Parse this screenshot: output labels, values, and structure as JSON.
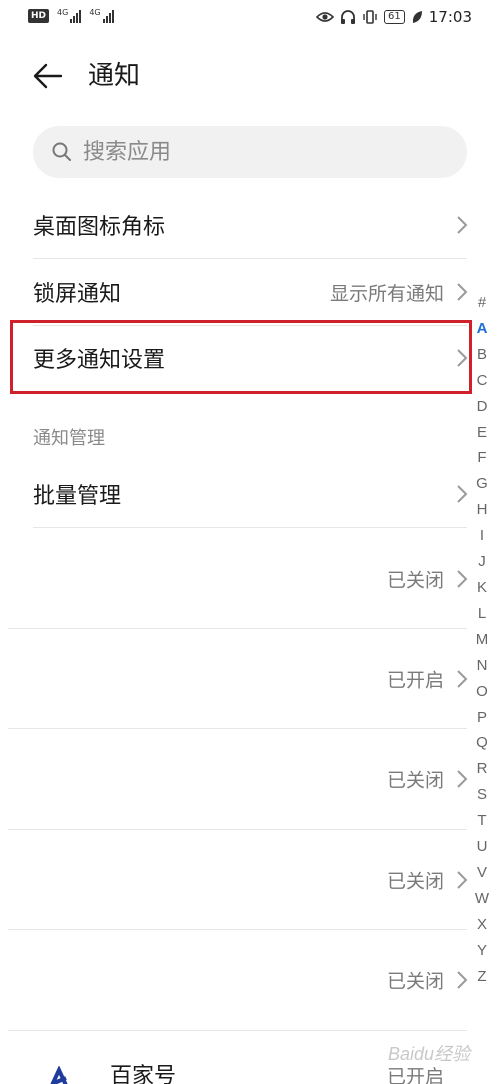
{
  "status_bar": {
    "hd_badge": "HD",
    "signal_1": "4G",
    "signal_2": "4G",
    "battery": "61",
    "time": "17:03"
  },
  "header": {
    "title": "通知"
  },
  "search": {
    "placeholder": "搜索应用"
  },
  "settings": [
    {
      "label": "桌面图标角标",
      "value": ""
    },
    {
      "label": "锁屏通知",
      "value": "显示所有通知"
    },
    {
      "label": "更多通知设置",
      "value": ""
    }
  ],
  "section": {
    "title": "通知管理",
    "batch_label": "批量管理"
  },
  "apps": [
    {
      "name": "",
      "status": "已关闭"
    },
    {
      "name": "",
      "status": "已开启"
    },
    {
      "name": "",
      "status": "已关闭"
    },
    {
      "name": "",
      "status": "已关闭"
    },
    {
      "name": "",
      "status": "已关闭"
    }
  ],
  "last_app": {
    "name": "百家号",
    "status": "已开启"
  },
  "index_letters": [
    "#",
    "A",
    "B",
    "C",
    "D",
    "E",
    "F",
    "G",
    "H",
    "I",
    "J",
    "K",
    "L",
    "M",
    "N",
    "O",
    "P",
    "Q",
    "R",
    "S",
    "T",
    "U",
    "V",
    "W",
    "X",
    "Y",
    "Z"
  ],
  "active_letter": "A",
  "watermark": "Baidu经验",
  "colors": {
    "highlight": "#d0202a",
    "accent": "#1c6fd6"
  }
}
